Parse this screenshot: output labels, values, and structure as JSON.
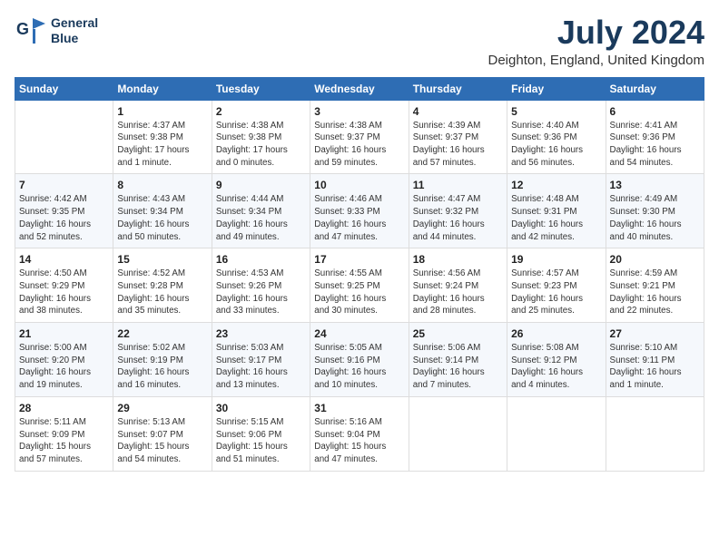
{
  "header": {
    "logo_line1": "General",
    "logo_line2": "Blue",
    "month_year": "July 2024",
    "location": "Deighton, England, United Kingdom"
  },
  "weekdays": [
    "Sunday",
    "Monday",
    "Tuesday",
    "Wednesday",
    "Thursday",
    "Friday",
    "Saturday"
  ],
  "weeks": [
    [
      {
        "day": "",
        "info": ""
      },
      {
        "day": "1",
        "info": "Sunrise: 4:37 AM\nSunset: 9:38 PM\nDaylight: 17 hours\nand 1 minute."
      },
      {
        "day": "2",
        "info": "Sunrise: 4:38 AM\nSunset: 9:38 PM\nDaylight: 17 hours\nand 0 minutes."
      },
      {
        "day": "3",
        "info": "Sunrise: 4:38 AM\nSunset: 9:37 PM\nDaylight: 16 hours\nand 59 minutes."
      },
      {
        "day": "4",
        "info": "Sunrise: 4:39 AM\nSunset: 9:37 PM\nDaylight: 16 hours\nand 57 minutes."
      },
      {
        "day": "5",
        "info": "Sunrise: 4:40 AM\nSunset: 9:36 PM\nDaylight: 16 hours\nand 56 minutes."
      },
      {
        "day": "6",
        "info": "Sunrise: 4:41 AM\nSunset: 9:36 PM\nDaylight: 16 hours\nand 54 minutes."
      }
    ],
    [
      {
        "day": "7",
        "info": "Sunrise: 4:42 AM\nSunset: 9:35 PM\nDaylight: 16 hours\nand 52 minutes."
      },
      {
        "day": "8",
        "info": "Sunrise: 4:43 AM\nSunset: 9:34 PM\nDaylight: 16 hours\nand 50 minutes."
      },
      {
        "day": "9",
        "info": "Sunrise: 4:44 AM\nSunset: 9:34 PM\nDaylight: 16 hours\nand 49 minutes."
      },
      {
        "day": "10",
        "info": "Sunrise: 4:46 AM\nSunset: 9:33 PM\nDaylight: 16 hours\nand 47 minutes."
      },
      {
        "day": "11",
        "info": "Sunrise: 4:47 AM\nSunset: 9:32 PM\nDaylight: 16 hours\nand 44 minutes."
      },
      {
        "day": "12",
        "info": "Sunrise: 4:48 AM\nSunset: 9:31 PM\nDaylight: 16 hours\nand 42 minutes."
      },
      {
        "day": "13",
        "info": "Sunrise: 4:49 AM\nSunset: 9:30 PM\nDaylight: 16 hours\nand 40 minutes."
      }
    ],
    [
      {
        "day": "14",
        "info": "Sunrise: 4:50 AM\nSunset: 9:29 PM\nDaylight: 16 hours\nand 38 minutes."
      },
      {
        "day": "15",
        "info": "Sunrise: 4:52 AM\nSunset: 9:28 PM\nDaylight: 16 hours\nand 35 minutes."
      },
      {
        "day": "16",
        "info": "Sunrise: 4:53 AM\nSunset: 9:26 PM\nDaylight: 16 hours\nand 33 minutes."
      },
      {
        "day": "17",
        "info": "Sunrise: 4:55 AM\nSunset: 9:25 PM\nDaylight: 16 hours\nand 30 minutes."
      },
      {
        "day": "18",
        "info": "Sunrise: 4:56 AM\nSunset: 9:24 PM\nDaylight: 16 hours\nand 28 minutes."
      },
      {
        "day": "19",
        "info": "Sunrise: 4:57 AM\nSunset: 9:23 PM\nDaylight: 16 hours\nand 25 minutes."
      },
      {
        "day": "20",
        "info": "Sunrise: 4:59 AM\nSunset: 9:21 PM\nDaylight: 16 hours\nand 22 minutes."
      }
    ],
    [
      {
        "day": "21",
        "info": "Sunrise: 5:00 AM\nSunset: 9:20 PM\nDaylight: 16 hours\nand 19 minutes."
      },
      {
        "day": "22",
        "info": "Sunrise: 5:02 AM\nSunset: 9:19 PM\nDaylight: 16 hours\nand 16 minutes."
      },
      {
        "day": "23",
        "info": "Sunrise: 5:03 AM\nSunset: 9:17 PM\nDaylight: 16 hours\nand 13 minutes."
      },
      {
        "day": "24",
        "info": "Sunrise: 5:05 AM\nSunset: 9:16 PM\nDaylight: 16 hours\nand 10 minutes."
      },
      {
        "day": "25",
        "info": "Sunrise: 5:06 AM\nSunset: 9:14 PM\nDaylight: 16 hours\nand 7 minutes."
      },
      {
        "day": "26",
        "info": "Sunrise: 5:08 AM\nSunset: 9:12 PM\nDaylight: 16 hours\nand 4 minutes."
      },
      {
        "day": "27",
        "info": "Sunrise: 5:10 AM\nSunset: 9:11 PM\nDaylight: 16 hours\nand 1 minute."
      }
    ],
    [
      {
        "day": "28",
        "info": "Sunrise: 5:11 AM\nSunset: 9:09 PM\nDaylight: 15 hours\nand 57 minutes."
      },
      {
        "day": "29",
        "info": "Sunrise: 5:13 AM\nSunset: 9:07 PM\nDaylight: 15 hours\nand 54 minutes."
      },
      {
        "day": "30",
        "info": "Sunrise: 5:15 AM\nSunset: 9:06 PM\nDaylight: 15 hours\nand 51 minutes."
      },
      {
        "day": "31",
        "info": "Sunrise: 5:16 AM\nSunset: 9:04 PM\nDaylight: 15 hours\nand 47 minutes."
      },
      {
        "day": "",
        "info": ""
      },
      {
        "day": "",
        "info": ""
      },
      {
        "day": "",
        "info": ""
      }
    ]
  ]
}
